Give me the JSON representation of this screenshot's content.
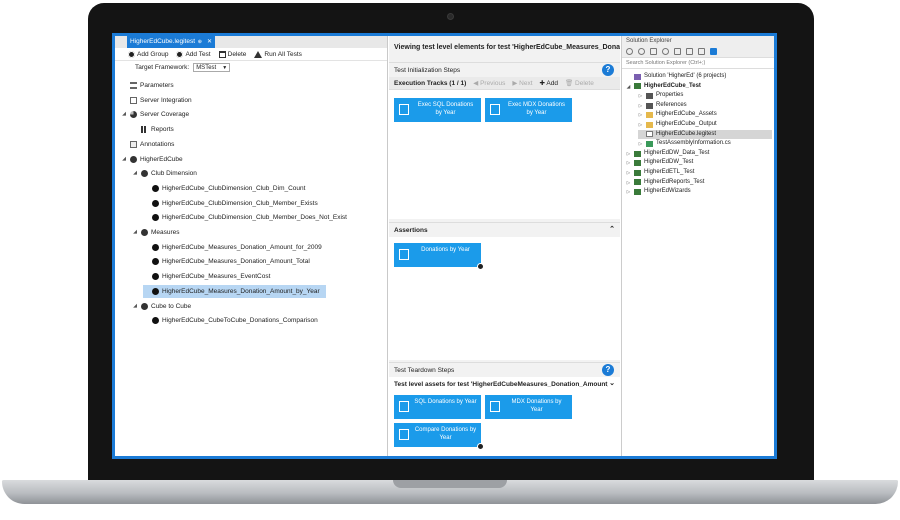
{
  "left_pane": {
    "tab": {
      "title": "HigherEdCube.legitest",
      "pin_glyph": "⊕",
      "close_glyph": "✕"
    },
    "toolbar": [
      {
        "label": "Add Group",
        "icon": "gear-icon"
      },
      {
        "label": "Add Test",
        "icon": "gear-icon"
      },
      {
        "label": "Delete",
        "icon": "trash-icon"
      },
      {
        "label": "Run All Tests",
        "icon": "flask-icon"
      }
    ],
    "framework": {
      "label": "Target Framework:",
      "value": "MSTest"
    },
    "tree": [
      {
        "label": "Parameters",
        "icon": "list",
        "indent": 1,
        "toggle": ""
      },
      {
        "label": "Server Integration",
        "icon": "box",
        "indent": 1,
        "toggle": ""
      },
      {
        "label": "Server Coverage",
        "icon": "pie",
        "indent": 1,
        "toggle": "◢"
      },
      {
        "label": "Reports",
        "icon": "bars",
        "indent": 2,
        "toggle": ""
      },
      {
        "label": "Annotations",
        "icon": "note",
        "indent": 1,
        "toggle": ""
      },
      {
        "label": "HigherEdCube",
        "icon": "gear",
        "indent": 1,
        "toggle": "◢"
      },
      {
        "label": "Club Dimension",
        "icon": "gear",
        "indent": 2,
        "toggle": "◢"
      },
      {
        "label": "HigherEdCube_ClubDimension_Club_Dim_Count",
        "icon": "dot",
        "indent": 3,
        "toggle": ""
      },
      {
        "label": "HigherEdCube_ClubDimension_Club_Member_Exists",
        "icon": "dot",
        "indent": 3,
        "toggle": ""
      },
      {
        "label": "HigherEdCube_ClubDimension_Club_Member_Does_Not_Exist",
        "icon": "dot",
        "indent": 3,
        "toggle": ""
      },
      {
        "label": "Measures",
        "icon": "gear",
        "indent": 2,
        "toggle": "◢"
      },
      {
        "label": "HigherEdCube_Measures_Donation_Amount_for_2009",
        "icon": "dot",
        "indent": 3,
        "toggle": ""
      },
      {
        "label": "HigherEdCube_Measures_Donation_Amount_Total",
        "icon": "dot",
        "indent": 3,
        "toggle": ""
      },
      {
        "label": "HigherEdCube_Measures_EventCost",
        "icon": "dot",
        "indent": 3,
        "toggle": ""
      },
      {
        "label": "HigherEdCube_Measures_Donation_Amount_by_Year",
        "icon": "dot",
        "indent": 3,
        "toggle": "",
        "selected": true
      },
      {
        "label": "Cube to Cube",
        "icon": "gear",
        "indent": 2,
        "toggle": "◢"
      },
      {
        "label": "HigherEdCube_CubeToCube_Donations_Comparison",
        "icon": "dot",
        "indent": 3,
        "toggle": ""
      }
    ]
  },
  "middle_pane": {
    "title": "Viewing test level elements for test 'HigherEdCube_Measures_Donation_Amount_by_Year'",
    "init": {
      "header": "Test Initialization Steps",
      "help": "?",
      "tracks_label": "Execution Tracks (1 / 1)",
      "previous": "◀ Previous",
      "next": "▶ Next",
      "add": "✚ Add",
      "delete": "🗑 Delete",
      "tiles": [
        "Exec SQL Donations by Year",
        "Exec MDX Donations by Year"
      ]
    },
    "assertions": {
      "header": "Assertions",
      "chevron": "⌃",
      "tiles": [
        "Donations by Year"
      ]
    },
    "teardown": {
      "header": "Test Teardown Steps",
      "help": "?",
      "assets_header": "Test level assets for test 'HigherEdCubeMeasures_Donation_Amount_by_Year'",
      "chevron": "⌄",
      "tiles": [
        "SQL Donations by Year",
        "MDX Donations by Year",
        "Compare Donations by Year"
      ]
    }
  },
  "solution_explorer": {
    "title": "Solution Explorer",
    "search_placeholder": "Search Solution Explorer (Ctrl+;)",
    "items": [
      {
        "label": "Solution 'HigherEd' (6 projects)",
        "icon": "sol",
        "indent": 0,
        "toggle": ""
      },
      {
        "label": "HigherEdCube_Test",
        "icon": "proj",
        "indent": 1,
        "toggle": "◢",
        "bold": true
      },
      {
        "label": "Properties",
        "icon": "ref",
        "indent": 2,
        "toggle": "▷"
      },
      {
        "label": "References",
        "icon": "ref",
        "indent": 2,
        "toggle": "▷"
      },
      {
        "label": "HigherEdCube_Assets",
        "icon": "folder",
        "indent": 2,
        "toggle": "▷"
      },
      {
        "label": "HigherEdCube_Output",
        "icon": "folder",
        "indent": 2,
        "toggle": "▷"
      },
      {
        "label": "HigherEdCube.legitest",
        "icon": "file",
        "indent": 2,
        "toggle": "",
        "selected": true
      },
      {
        "label": "TestAssemblyInformation.cs",
        "icon": "cs",
        "indent": 2,
        "toggle": "▷"
      },
      {
        "label": "HigherEdDW_Data_Test",
        "icon": "proj",
        "indent": 1,
        "toggle": "▷"
      },
      {
        "label": "HigherEdDW_Test",
        "icon": "proj",
        "indent": 1,
        "toggle": "▷"
      },
      {
        "label": "HigherEdETL_Test",
        "icon": "proj",
        "indent": 1,
        "toggle": "▷"
      },
      {
        "label": "HigherEdReports_Test",
        "icon": "proj",
        "indent": 1,
        "toggle": "▷"
      },
      {
        "label": "HigherEdWizards",
        "icon": "proj",
        "indent": 1,
        "toggle": "▷"
      }
    ]
  }
}
